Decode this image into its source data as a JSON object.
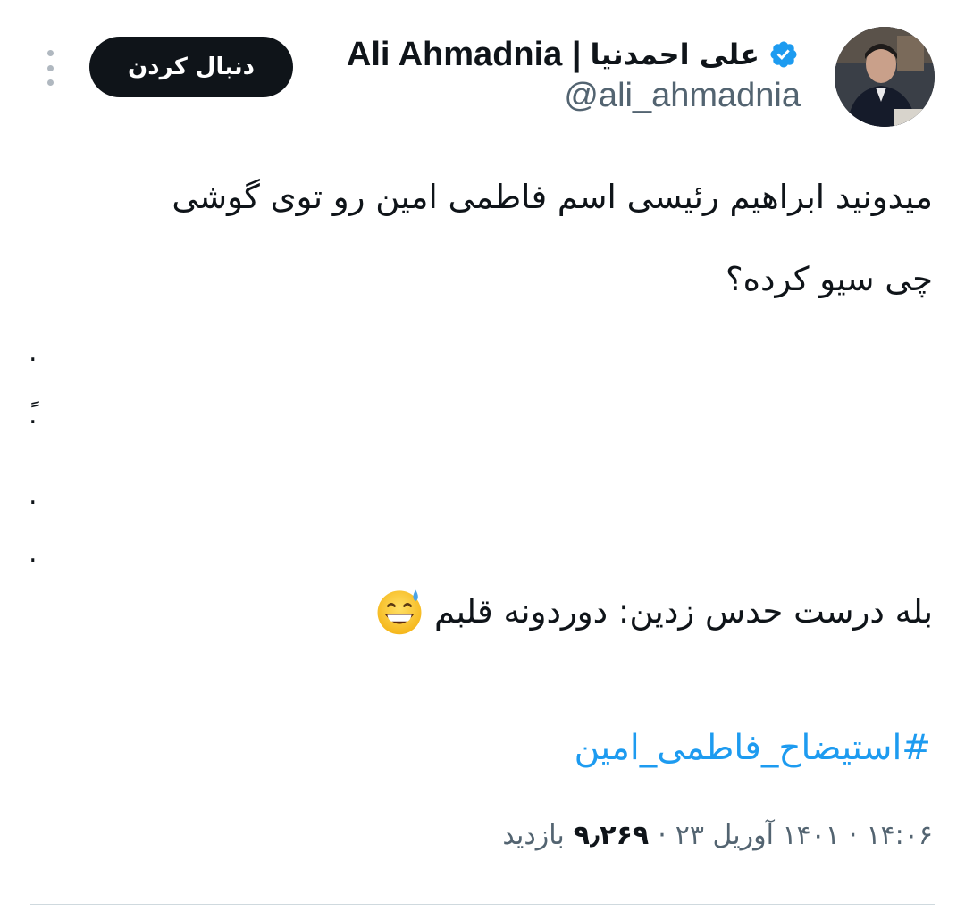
{
  "author": {
    "display_name_latin": "Ali Ahmadnia |",
    "display_name_persian": "علی احمدنیا",
    "handle": "@ali_ahmadnia",
    "verified": true,
    "verified_color": "#1d9bf0"
  },
  "actions": {
    "follow_label": "دنبال کردن",
    "more_icon": "more-vertical-icon"
  },
  "tweet": {
    "line1": "میدونید ابراهیم رئیسی اسم فاطمی امین رو توی گوشی",
    "line2": "چی سیو کرده؟",
    "dots": [
      ".",
      "ً.",
      ".",
      "."
    ],
    "answer": "بله درست حدس زدین: دوردونه قلبم",
    "answer_emoji": "grinning-face-with-sweat-emoji",
    "hashtag": "#استیضاح_فاطمی_امین"
  },
  "meta": {
    "time": "۱۴:۰۶",
    "separator1": "·",
    "date": "۱۴۰۱ آوریل ۲۳",
    "separator2": "·",
    "views_count": "۹٫۲۶۹",
    "views_label": "بازدید"
  },
  "colors": {
    "text": "#0f1419",
    "secondary": "#536471",
    "link": "#1d9bf0",
    "follow_bg": "#0f1419"
  }
}
